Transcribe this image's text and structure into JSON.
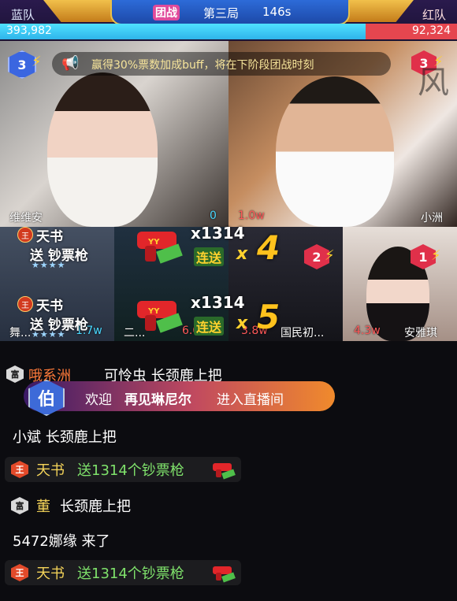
{
  "battle": {
    "blue_team": "蓝队",
    "red_team": "红队",
    "mode": "团战",
    "round": "第三局",
    "timer": "146s",
    "blue_score": "393,982",
    "red_score": "92,324",
    "blue_share": 0.8
  },
  "announcement": "赢得30%票数加成buff，将在下阶段团战时刻",
  "anchors": [
    {
      "name": "维维安",
      "votes": "0",
      "rank": "3"
    },
    {
      "name": "小洲",
      "votes": "1.0w",
      "rank": "3"
    },
    {
      "name": "舞...",
      "votes": "1.7w",
      "rank": ""
    },
    {
      "name": "二...",
      "votes": "6.0w",
      "rank": ""
    },
    {
      "name": "国民初...",
      "votes": "3.8w",
      "rank": "2"
    },
    {
      "name": "安雅琪",
      "votes": "4.3w",
      "rank": "1"
    }
  ],
  "seal_text": "风",
  "gifts": [
    {
      "badge": "王",
      "user": "天书",
      "action": "送 钞票枪",
      "multiplier": "x1314",
      "combo_label": "连送",
      "combo_x": "x",
      "combo_count": "4",
      "stars": "★★★★"
    },
    {
      "badge": "王",
      "user": "天书",
      "action": "送 钞票枪",
      "multiplier": "x1314",
      "combo_label": "连送",
      "combo_x": "x",
      "combo_count": "5",
      "stars": "★★★★"
    }
  ],
  "chat": [
    {
      "badge": "富",
      "user": "哦系洲",
      "text": "可怜虫 长颈鹿上把"
    },
    {
      "badge": "",
      "user": "",
      "text": "小斌 长颈鹿上把"
    },
    {
      "badge": "王",
      "user": "天书",
      "text": "送1314个钞票枪",
      "gift": true
    },
    {
      "badge": "富",
      "user": "董",
      "text": "长颈鹿上把"
    },
    {
      "badge": "",
      "user": "",
      "text": "5472娜缘 来了"
    },
    {
      "badge": "王",
      "user": "天书",
      "text": "送1314个钞票枪",
      "gift": true
    }
  ],
  "welcome": {
    "badge": "伯",
    "prefix": "欢迎",
    "name": "再见琳尼尔",
    "suffix": "进入直播间"
  }
}
